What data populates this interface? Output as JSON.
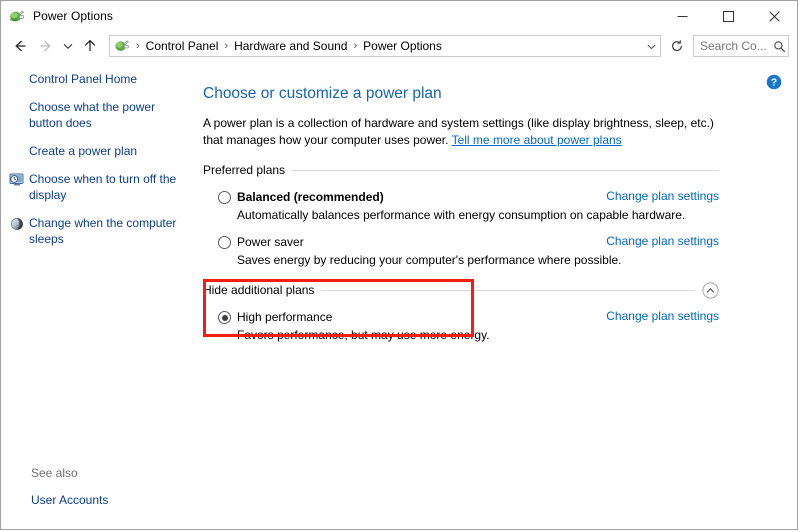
{
  "window": {
    "title": "Power Options",
    "icon": "power-plug-icon",
    "controls": {
      "minimize": "minimize-icon",
      "maximize": "maximize-icon",
      "close": "close-icon"
    }
  },
  "navbar": {
    "back": "back-arrow-icon",
    "forward": "forward-arrow-icon",
    "recent": "chevron-down-icon",
    "up": "up-arrow-icon",
    "address_icon": "power-plug-icon",
    "breadcrumbs": [
      "Control Panel",
      "Hardware and Sound",
      "Power Options"
    ],
    "separator": "›",
    "address_dropdown": "chevron-down-icon",
    "refresh": "refresh-icon",
    "search": {
      "placeholder": "Search Co...",
      "value": "",
      "icon": "search-icon"
    }
  },
  "sidebar": {
    "items": [
      {
        "label": "Control Panel Home",
        "icon": null
      },
      {
        "label": "Choose what the power button does",
        "icon": null
      },
      {
        "label": "Create a power plan",
        "icon": null
      },
      {
        "label": "Choose when to turn off the display",
        "icon": "display-clock-icon"
      },
      {
        "label": "Change when the computer sleeps",
        "icon": "moon-sleep-icon"
      }
    ],
    "see_also_label": "See also",
    "see_also_link": "User Accounts"
  },
  "main": {
    "help_button": "help-question-icon",
    "heading": "Choose or customize a power plan",
    "description_part1": "A power plan is a collection of hardware and system settings (like display brightness, sleep, etc.) that manages how your computer uses power. ",
    "description_link": "Tell me more about power plans",
    "sections": [
      {
        "title": "Preferred plans",
        "toggle_icon": null,
        "plans": [
          {
            "name": "Balanced (recommended)",
            "bold": true,
            "selected": false,
            "description": "Automatically balances performance with energy consumption on capable hardware.",
            "change_link": "Change plan settings",
            "highlighted": false
          },
          {
            "name": "Power saver",
            "bold": false,
            "selected": false,
            "description": "Saves energy by reducing your computer's performance where possible.",
            "change_link": "Change plan settings",
            "highlighted": false
          }
        ]
      },
      {
        "title": "Hide additional plans",
        "toggle_icon": "chevron-up-circle-icon",
        "plans": [
          {
            "name": "High performance",
            "bold": false,
            "selected": true,
            "description": "Favors performance, but may use more energy.",
            "change_link": "Change plan settings",
            "highlighted": true
          }
        ]
      }
    ]
  },
  "colors": {
    "link_blue": "#0066cc",
    "sidebar_link": "#0b3d91",
    "heading_blue": "#1464b4",
    "highlight_red": "#f01f12",
    "window_border": "#a0a0a0",
    "rule_gray": "#d6d6d6"
  }
}
